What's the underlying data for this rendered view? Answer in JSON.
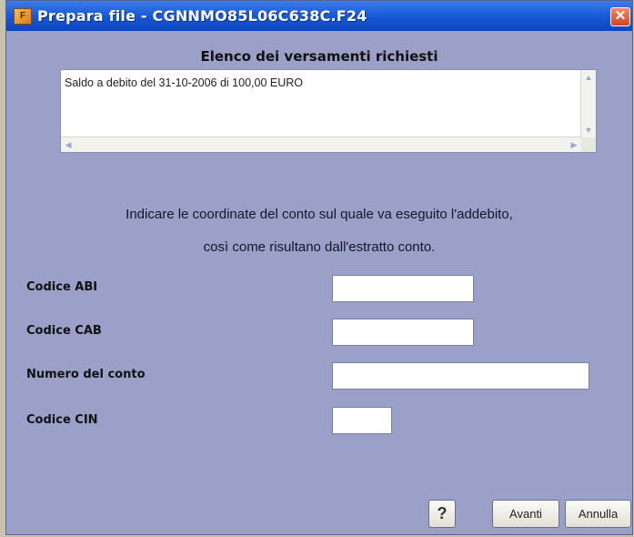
{
  "window": {
    "title": "Prepara file - CGNNMO85L06C638C.F24",
    "app_icon": "app-icon",
    "close_symbol": "✕"
  },
  "payments": {
    "heading": "Elenco dei versamenti richiesti",
    "items": [
      "Saldo a debito del 31-10-2006 di 100,00 EURO"
    ]
  },
  "instructions": {
    "line1": "Indicare le coordinate del conto sul quale va eseguito l'addebito,",
    "line2": "così come risultano dall'estratto conto."
  },
  "form": {
    "abi_label": "Codice ABI",
    "abi_value": "",
    "cab_label": "Codice CAB",
    "cab_value": "",
    "account_label": "Numero del conto",
    "account_value": "",
    "cin_label": "Codice CIN",
    "cin_value": ""
  },
  "buttons": {
    "help": "?",
    "next": "Avanti",
    "cancel": "Annulla"
  },
  "colors": {
    "titlebar": "#1556d6",
    "window_bg": "#9ba0c8"
  }
}
